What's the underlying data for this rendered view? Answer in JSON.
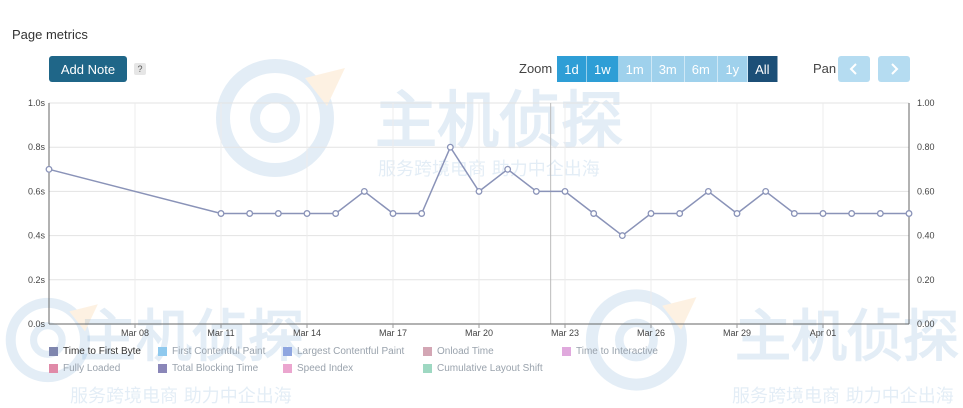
{
  "page": {
    "title": "Page metrics",
    "add_note_label": "Add Note",
    "help_label": "?",
    "zoom_label": "Zoom",
    "zoom_options": [
      {
        "label": "1d",
        "state": "enabled"
      },
      {
        "label": "1w",
        "state": "enabled"
      },
      {
        "label": "1m",
        "state": "disabled"
      },
      {
        "label": "3m",
        "state": "disabled"
      },
      {
        "label": "6m",
        "state": "disabled"
      },
      {
        "label": "1y",
        "state": "disabled"
      },
      {
        "label": "All",
        "state": "selected"
      }
    ],
    "pan_label": "Pan",
    "pan_left_icon": "chevron-left-icon",
    "pan_right_icon": "chevron-right-icon"
  },
  "watermark": {
    "brand": "主机侦探",
    "slogan": "服务跨境电商 助力中企出海"
  },
  "chart_data": {
    "type": "line",
    "x_tick_labels": [
      "Mar 08",
      "Mar 11",
      "Mar 14",
      "Mar 17",
      "Mar 20",
      "Mar 23",
      "Mar 26",
      "Mar 29",
      "Apr 01"
    ],
    "y_left_tick_labels": [
      "0.0s",
      "0.2s",
      "0.4s",
      "0.6s",
      "0.8s",
      "1.0s"
    ],
    "y_right_tick_labels": [
      "0.00",
      "0.20",
      "0.40",
      "0.60",
      "0.80",
      "1.00"
    ],
    "ylim": [
      0,
      1
    ],
    "series": [
      {
        "name": "Time to First Byte",
        "color": "#8a93b8",
        "x": [
          "Mar 05",
          "Mar 11",
          "Mar 12",
          "Mar 13",
          "Mar 14",
          "Mar 15",
          "Mar 16",
          "Mar 17",
          "Mar 18",
          "Mar 19",
          "Mar 20",
          "Mar 21",
          "Mar 22",
          "Mar 23",
          "Mar 24",
          "Mar 25",
          "Mar 26",
          "Mar 27",
          "Mar 28",
          "Mar 29",
          "Mar 30",
          "Mar 31",
          "Apr 01",
          "Apr 02",
          "Apr 03",
          "Apr 04"
        ],
        "values": [
          0.7,
          0.5,
          0.5,
          0.5,
          0.5,
          0.5,
          0.6,
          0.5,
          0.5,
          0.8,
          0.6,
          0.7,
          0.6,
          0.6,
          0.5,
          0.4,
          0.5,
          0.5,
          0.6,
          0.5,
          0.6,
          0.5,
          0.5,
          0.5,
          0.5,
          0.5
        ]
      }
    ],
    "legend": [
      {
        "name": "Time to First Byte",
        "color": "#7f86ae",
        "active": true
      },
      {
        "name": "First Contentful Paint",
        "color": "#8fc9ee",
        "active": false
      },
      {
        "name": "Largest Contentful Paint",
        "color": "#8fa6e0",
        "active": false
      },
      {
        "name": "Onload Time",
        "color": "#d3a6b4",
        "active": false
      },
      {
        "name": "Time to Interactive",
        "color": "#e0a9dd",
        "active": false
      },
      {
        "name": "Fully Loaded",
        "color": "#e08aa8",
        "active": false
      },
      {
        "name": "Total Blocking Time",
        "color": "#8a86b8",
        "active": false
      },
      {
        "name": "Speed Index",
        "color": "#eba6cf",
        "active": false
      },
      {
        "name": "Cumulative Layout Shift",
        "color": "#9ed8c2",
        "active": false
      }
    ],
    "grid": true,
    "legend_position": "bottom"
  }
}
